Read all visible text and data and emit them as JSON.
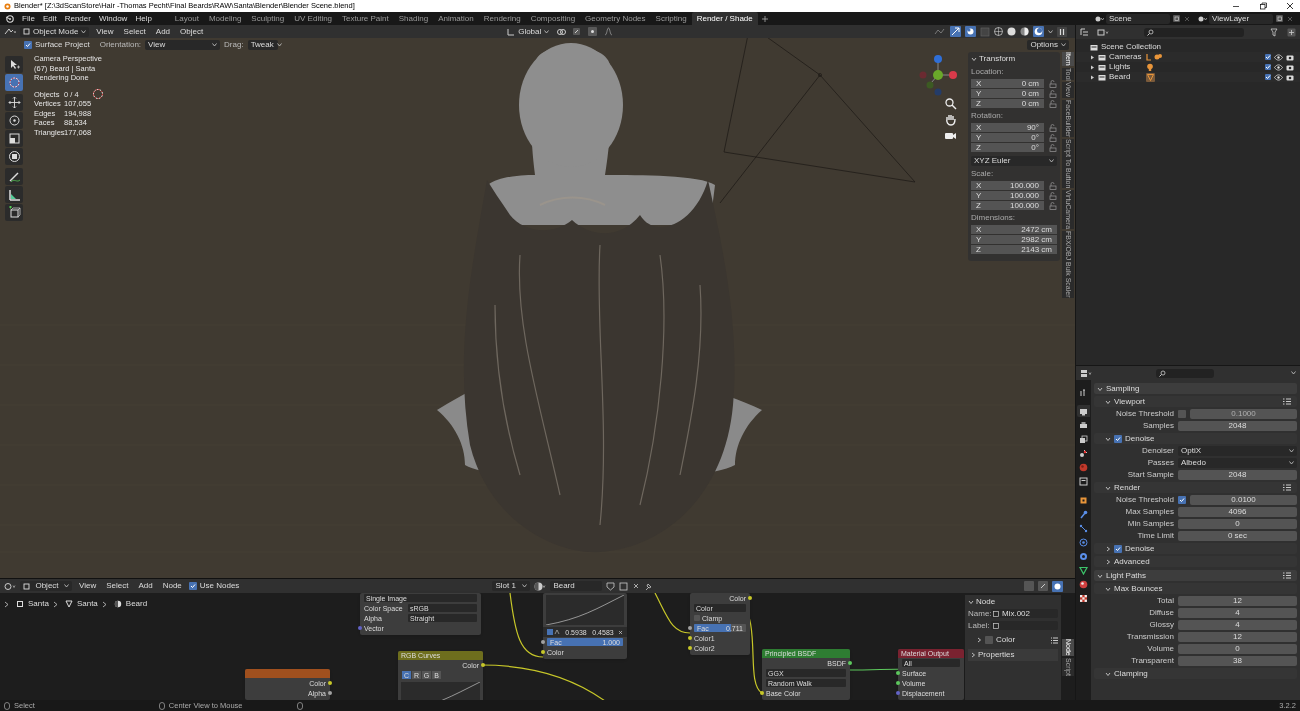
{
  "title_bar": {
    "title": "Blender* [Z:\\3dScanStore\\Hair  -Thomas Pecht\\Final Beards\\RAW\\Santa\\Blender\\Blender Scene.blend]"
  },
  "menus": [
    "File",
    "Edit",
    "Render",
    "Window",
    "Help"
  ],
  "workspaces": [
    {
      "label": "Layout",
      "selected": false
    },
    {
      "label": "Modeling",
      "selected": false
    },
    {
      "label": "Sculpting",
      "selected": false
    },
    {
      "label": "UV Editing",
      "selected": false
    },
    {
      "label": "Texture Paint",
      "selected": false
    },
    {
      "label": "Shading",
      "selected": false
    },
    {
      "label": "Animation",
      "selected": false
    },
    {
      "label": "Rendering",
      "selected": false
    },
    {
      "label": "Compositing",
      "selected": false
    },
    {
      "label": "Geometry Nodes",
      "selected": false
    },
    {
      "label": "Scripting",
      "selected": false
    },
    {
      "label": "Render / Shade",
      "selected": true
    }
  ],
  "scene": "Scene",
  "view_layer": "ViewLayer",
  "viewport": {
    "mode": "Object Mode",
    "menus": [
      "View",
      "Select",
      "Add",
      "Object"
    ],
    "orientation_global": "Global",
    "surface_project": {
      "label": "Surface Project",
      "checked": true
    },
    "orientation_label": "Orientation:",
    "orientation": "View",
    "drag_label": "Drag:",
    "drag": "Tweak",
    "options": "Options",
    "tools": [
      {
        "kind": "select",
        "selected": false
      },
      {
        "kind": "select_circle",
        "selected": true
      },
      {
        "kind": "move",
        "selected": false
      },
      {
        "kind": "rotate",
        "selected": false
      },
      {
        "kind": "scale",
        "selected": false
      },
      {
        "kind": "transform",
        "selected": false
      },
      {
        "kind": "annotate",
        "selected": false
      },
      {
        "kind": "measure",
        "selected": false
      },
      {
        "kind": "add_cube",
        "selected": false
      }
    ],
    "info": [
      "Camera Perspective",
      "(67) Beard | Santa",
      "Rendering Done"
    ],
    "stats": [
      {
        "label": "Objects",
        "value": "0 / 4"
      },
      {
        "label": "Vertices",
        "value": "107,055"
      },
      {
        "label": "Edges",
        "value": "194,988"
      },
      {
        "label": "Faces",
        "value": "88,534"
      },
      {
        "label": "Triangles",
        "value": "177,068"
      }
    ],
    "transform": {
      "title": "Transform",
      "groups": [
        {
          "kind": "locked_vector",
          "label": "Location:",
          "fields": [
            {
              "axis": "X",
              "value": "0 cm"
            },
            {
              "axis": "Y",
              "value": "0 cm"
            },
            {
              "axis": "Z",
              "value": "0 cm"
            }
          ]
        },
        {
          "kind": "locked_vector",
          "label": "Rotation:",
          "fields": [
            {
              "axis": "X",
              "value": "90°"
            },
            {
              "axis": "Y",
              "value": "0°"
            },
            {
              "axis": "Z",
              "value": "0°"
            }
          ]
        },
        {
          "kind": "dropdown",
          "value": "XYZ Euler"
        },
        {
          "kind": "locked_vector",
          "label": "Scale:",
          "fields": [
            {
              "axis": "X",
              "value": "100.000"
            },
            {
              "axis": "Y",
              "value": "100.000"
            },
            {
              "axis": "Z",
              "value": "100.000"
            }
          ]
        },
        {
          "kind": "vector",
          "label": "Dimensions:",
          "fields": [
            {
              "axis": "X",
              "value": "2472 cm"
            },
            {
              "axis": "Y",
              "value": "2982 cm"
            },
            {
              "axis": "Z",
              "value": "2143 cm"
            }
          ]
        }
      ]
    },
    "sidebar_tabs": [
      {
        "label": "Item",
        "selected": true
      },
      {
        "label": "Tool",
        "selected": false
      },
      {
        "label": "View",
        "selected": false
      },
      {
        "label": "FaceBuilder",
        "selected": false
      },
      {
        "label": "Script To Button",
        "selected": false
      },
      {
        "label": "VirtuCamera",
        "selected": false
      },
      {
        "label": "FBX/OBJ Bulk Scaler",
        "selected": false
      }
    ]
  },
  "node_editor": {
    "object": "Object",
    "menus": [
      "View",
      "Select",
      "Add",
      "Node"
    ],
    "use_nodes": {
      "label": "Use Nodes",
      "checked": true
    },
    "slot": "Slot 1",
    "material": "Beard",
    "breadcrumbs": [
      "Santa",
      "Santa",
      "Beard"
    ],
    "nodes": [
      {
        "rows": [
          {
            "kind": "dropdown",
            "value": "Single Image"
          },
          {
            "kind": "dropdown",
            "label": "Color Space",
            "value": "sRGB"
          },
          {
            "kind": "dropdown",
            "label": "Alpha",
            "value": "Straight"
          },
          {
            "kind": "input",
            "label": "Vector",
            "color": "#6363c7"
          }
        ]
      },
      {
        "rows": [
          {
            "kind": "graph"
          },
          {
            "kind": "values",
            "values": [
              "0.5938",
              "0.4583"
            ]
          },
          {
            "kind": "slider",
            "label": "Fac",
            "value": "1.000",
            "level": 1,
            "color": "#a1a1a1"
          },
          {
            "kind": "input",
            "label": "Color",
            "color": "#c7c729"
          }
        ]
      },
      {
        "rows": [
          {
            "kind": "output",
            "label": "Color",
            "color": "#c7c729"
          },
          {
            "kind": "dropdown",
            "value": "Color"
          },
          {
            "kind": "check",
            "label": "Clamp",
            "checked": false
          },
          {
            "kind": "slider",
            "label": "Fac",
            "value": "0.711",
            "level": 0.711,
            "color": "#a1a1a1"
          },
          {
            "kind": "input",
            "label": "Color1",
            "color": "#c7c729"
          },
          {
            "kind": "input",
            "label": "Color2",
            "color": "#c7c729"
          }
        ]
      },
      {
        "color": "#a0501e",
        "rows": [
          {
            "kind": "output",
            "label": "Color",
            "color": "#c7c729"
          },
          {
            "kind": "output",
            "label": "Alpha",
            "color": "#a1a1a1"
          }
        ]
      },
      {
        "title": "RGB Curves",
        "color": "#6e6e1d",
        "rows": [
          {
            "kind": "output",
            "label": "Color",
            "color": "#c7c729"
          },
          {
            "kind": "buttons",
            "items": [
              {
                "label": "C",
                "selected": true
              },
              {
                "label": "R",
                "selected": false
              },
              {
                "label": "G",
                "selected": false
              },
              {
                "label": "B",
                "selected": false
              }
            ]
          },
          {
            "kind": "graph"
          }
        ]
      },
      {
        "title": "Principled BSDF",
        "color": "#2e7d32",
        "rows": [
          {
            "kind": "output",
            "label": "BSDF",
            "color": "#5dc85d"
          },
          {
            "kind": "dropdown",
            "value": "GGX"
          },
          {
            "kind": "dropdown",
            "value": "Random Walk"
          },
          {
            "kind": "input",
            "label": "Base Color",
            "color": "#c7c729"
          }
        ]
      },
      {
        "title": "Material Output",
        "color": "#7a2230",
        "rows": [
          {
            "kind": "dropdown",
            "value": "All"
          },
          {
            "kind": "input",
            "label": "Surface",
            "color": "#5dc85d"
          },
          {
            "kind": "input",
            "label": "Volume",
            "color": "#5dc85d"
          },
          {
            "kind": "input",
            "label": "Displacement",
            "color": "#6363c7"
          }
        ]
      }
    ],
    "sidebar": {
      "title": "Node",
      "name_label": "Name:",
      "name": "Mix.002",
      "label_label": "Label:",
      "color_panel": {
        "label": "Color",
        "checked": false,
        "expanded": false
      },
      "properties_panel": {
        "label": "Properties",
        "expanded": false
      }
    },
    "tabs": [
      {
        "label": "Node",
        "selected": true
      },
      {
        "label": "Script",
        "selected": false
      }
    ]
  },
  "outliner": {
    "root": "Scene Collection",
    "items": [
      {
        "label": "Cameras",
        "kind": "camera",
        "expanded": false,
        "checked": true
      },
      {
        "label": "Lights",
        "kind": "light",
        "expanded": false,
        "checked": true
      },
      {
        "label": "Beard",
        "kind": "mesh",
        "expanded": false,
        "checked": true
      }
    ]
  },
  "properties": {
    "tabs": [
      {
        "kind": "tool",
        "selected": false
      },
      {
        "kind": "render",
        "selected": true
      },
      {
        "kind": "output",
        "selected": false
      },
      {
        "kind": "view_layer",
        "selected": false
      },
      {
        "kind": "scene",
        "selected": false
      },
      {
        "kind": "world",
        "selected": false
      },
      {
        "kind": "collection",
        "selected": false
      },
      {
        "kind": "object",
        "selected": false
      },
      {
        "kind": "modifier",
        "selected": false
      },
      {
        "kind": "particles",
        "selected": false
      },
      {
        "kind": "physics",
        "selected": false
      },
      {
        "kind": "constraints",
        "selected": false
      },
      {
        "kind": "data",
        "selected": false
      },
      {
        "kind": "material",
        "selected": false
      },
      {
        "kind": "texture",
        "selected": false
      }
    ],
    "rows": [
      {
        "kind": "panel",
        "label": "Sampling",
        "expanded": true
      },
      {
        "kind": "subpanel",
        "label": "Viewport",
        "expanded": true,
        "has_presets": true
      },
      {
        "kind": "check_field",
        "label": "Noise Threshold",
        "checked": false,
        "value": "0.1000"
      },
      {
        "kind": "field",
        "label": "Samples",
        "value": "2048"
      },
      {
        "kind": "check_subpanel",
        "label": "Denoise",
        "checked": true,
        "expanded": true
      },
      {
        "kind": "dropdown",
        "label": "Denoiser",
        "value": "OptiX"
      },
      {
        "kind": "dropdown",
        "label": "Passes",
        "value": "Albedo"
      },
      {
        "kind": "field",
        "label": "Start Sample",
        "value": "2048"
      },
      {
        "kind": "subpanel",
        "label": "Render",
        "expanded": true,
        "has_presets": true
      },
      {
        "kind": "check_field",
        "label": "Noise Threshold",
        "checked": true,
        "value": "0.0100"
      },
      {
        "kind": "field",
        "label": "Max Samples",
        "value": "4096"
      },
      {
        "kind": "field",
        "label": "Min Samples",
        "value": "0"
      },
      {
        "kind": "field",
        "label": "Time Limit",
        "value": "0 sec"
      },
      {
        "kind": "check_subpanel",
        "label": "Denoise",
        "checked": true,
        "expanded": false
      },
      {
        "kind": "subpanel",
        "label": "Advanced",
        "expanded": false
      },
      {
        "kind": "panel",
        "label": "Light Paths",
        "expanded": true,
        "has_presets": true
      },
      {
        "kind": "subpanel",
        "label": "Max Bounces",
        "expanded": true
      },
      {
        "kind": "field",
        "label": "Total",
        "value": "12"
      },
      {
        "kind": "field",
        "label": "Diffuse",
        "value": "4"
      },
      {
        "kind": "field",
        "label": "Glossy",
        "value": "4"
      },
      {
        "kind": "field",
        "label": "Transmission",
        "value": "12"
      },
      {
        "kind": "field",
        "label": "Volume",
        "value": "0"
      },
      {
        "kind": "field",
        "label": "Transparent",
        "value": "38"
      },
      {
        "kind": "subpanel",
        "label": "Clamping",
        "expanded": true
      }
    ]
  },
  "status_bar": {
    "items": [
      "Select",
      "Center View to Mouse"
    ],
    "version": "3.2.2"
  }
}
